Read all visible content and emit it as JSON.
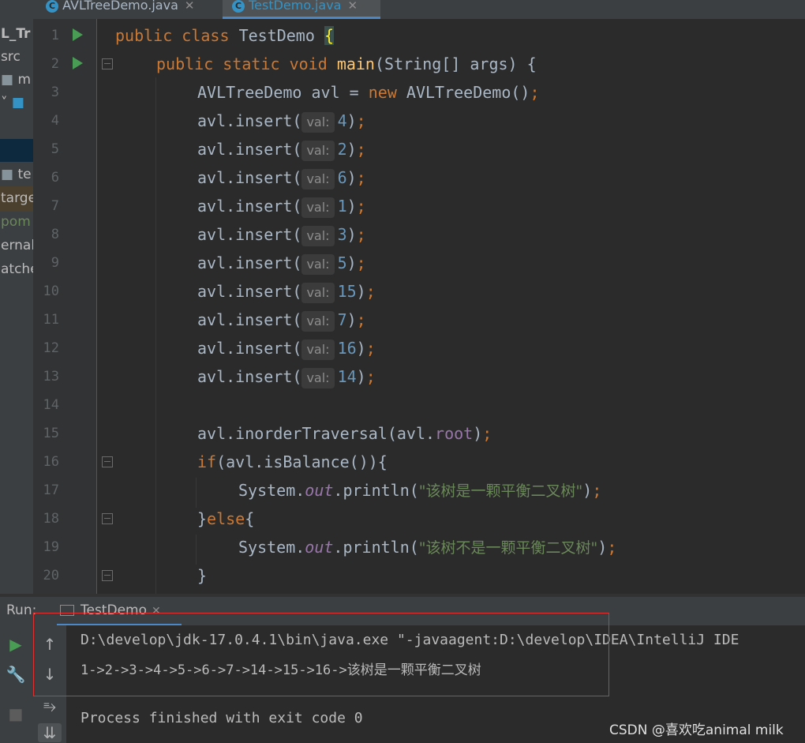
{
  "tabs": [
    {
      "label": "AVLTreeDemo.java",
      "active": false
    },
    {
      "label": "TestDemo.java",
      "active": true
    }
  ],
  "project_tree": {
    "items": [
      "L_Tr",
      "src",
      "m",
      "te",
      "targe",
      "pom",
      "ernal",
      "atche"
    ]
  },
  "editor": {
    "line_numbers": [
      "1",
      "2",
      "3",
      "4",
      "5",
      "6",
      "7",
      "8",
      "9",
      "10",
      "11",
      "12",
      "13",
      "14",
      "15",
      "16",
      "17",
      "18",
      "19",
      "20"
    ],
    "hint_label": "val:",
    "lines": {
      "l1": {
        "kw1": "public",
        "kw2": "class",
        "name": "TestDemo",
        "brace": "{"
      },
      "l2": {
        "kw1": "public",
        "kw2": "static",
        "kw3": "void",
        "fn": "main",
        "rest": "(String[] args) {"
      },
      "l3": {
        "a": "AVLTreeDemo avl = ",
        "kw": "new",
        "b": " AVLTreeDemo()",
        "semi": ";"
      },
      "insert_prefix": "avl.insert(",
      "insert_suffix": ")",
      "semi": ";",
      "insert_values": [
        "4",
        "2",
        "6",
        "1",
        "3",
        "5",
        "15",
        "7",
        "16",
        "14"
      ],
      "l15": {
        "a": "avl.inorderTraversal(avl.",
        "fld": "root",
        "b": ")",
        "semi": ";"
      },
      "l16": {
        "kw": "if",
        "rest": "(avl.isBalance()){"
      },
      "l17": {
        "a": "System.",
        "out": "out",
        "b": ".println(",
        "str": "\"该树是一颗平衡二叉树\"",
        "c": ")",
        "semi": ";"
      },
      "l18": {
        "a": "}",
        "kw": "else",
        "b": "{"
      },
      "l19": {
        "a": "System.",
        "out": "out",
        "b": ".println(",
        "str": "\"该树不是一颗平衡二叉树\"",
        "c": ")",
        "semi": ";"
      },
      "l20": {
        "a": "}"
      }
    }
  },
  "run_panel": {
    "label": "Run:",
    "tab": "TestDemo",
    "console_lines": [
      "D:\\develop\\jdk-17.0.4.1\\bin\\java.exe \"-javaagent:D:\\develop\\IDEA\\IntelliJ IDE",
      "1->2->3->4->5->6->7->14->15->16->该树是一颗平衡二叉树",
      "Process finished with exit code 0"
    ]
  },
  "watermark": "CSDN @喜欢吃animal milk",
  "colors": {
    "keyword": "#cc7832",
    "function": "#ffc66d",
    "number": "#6897bb",
    "string": "#6a8759",
    "field": "#9876aa",
    "highlight_box": "#e03030"
  }
}
